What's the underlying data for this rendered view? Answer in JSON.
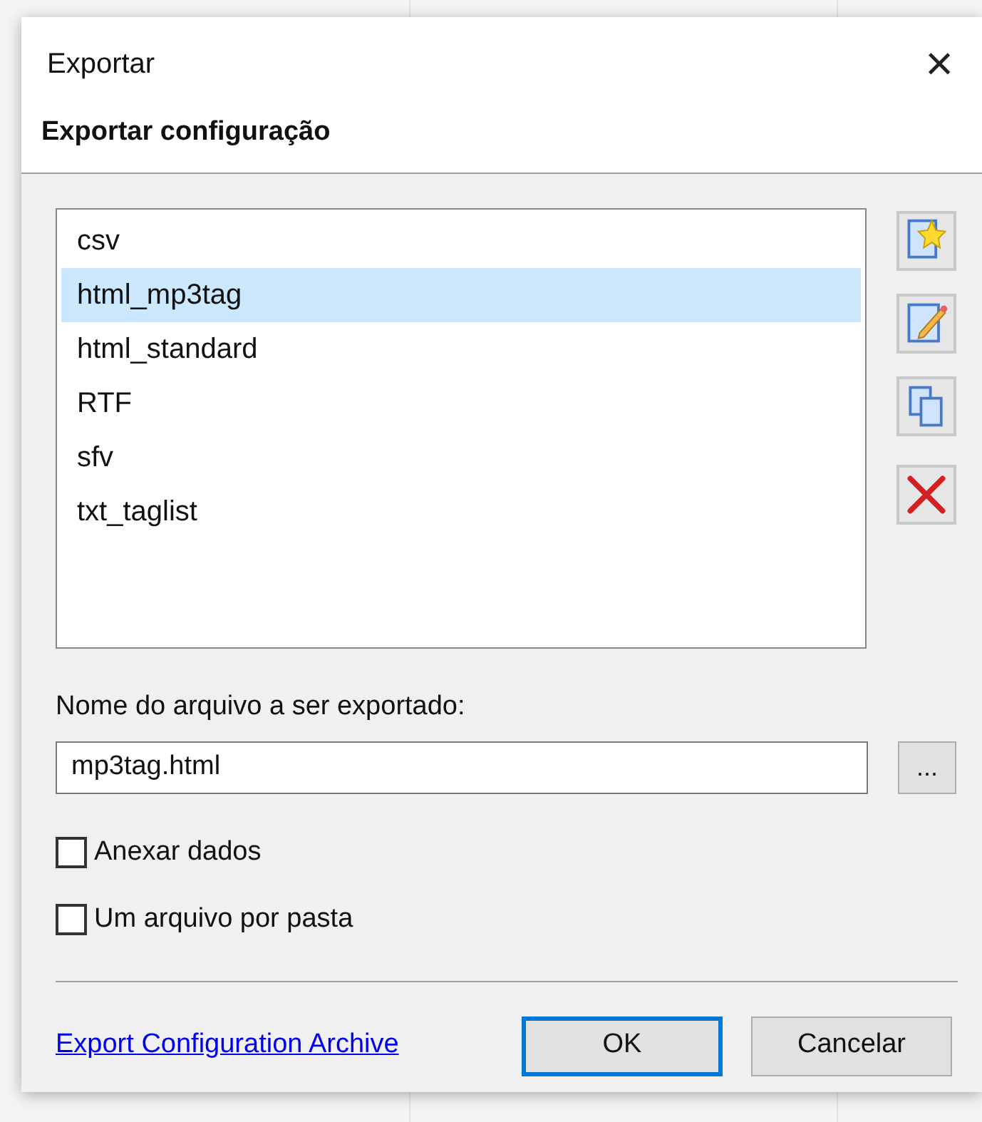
{
  "window": {
    "title": "Exportar",
    "close": "×"
  },
  "header": "Exportar configuração",
  "configurations": [
    {
      "label": "csv",
      "selected": false
    },
    {
      "label": "html_mp3tag",
      "selected": true
    },
    {
      "label": "html_standard",
      "selected": false
    },
    {
      "label": "RTF",
      "selected": false
    },
    {
      "label": "sfv",
      "selected": false
    },
    {
      "label": "txt_taglist",
      "selected": false
    }
  ],
  "side_buttons": [
    {
      "kind": "new"
    },
    {
      "kind": "edit"
    },
    {
      "kind": "copy"
    },
    {
      "kind": "delete"
    }
  ],
  "filename": {
    "label": "Nome do arquivo a ser exportado:",
    "value": "mp3tag.html",
    "browse": "..."
  },
  "options": [
    {
      "label": "Anexar dados",
      "checked": false
    },
    {
      "label": "Um arquivo por pasta",
      "checked": false
    }
  ],
  "link": "Export Configuration Archive",
  "buttons": [
    {
      "label": "OK",
      "default": true
    },
    {
      "label": "Cancelar",
      "default": false
    }
  ]
}
